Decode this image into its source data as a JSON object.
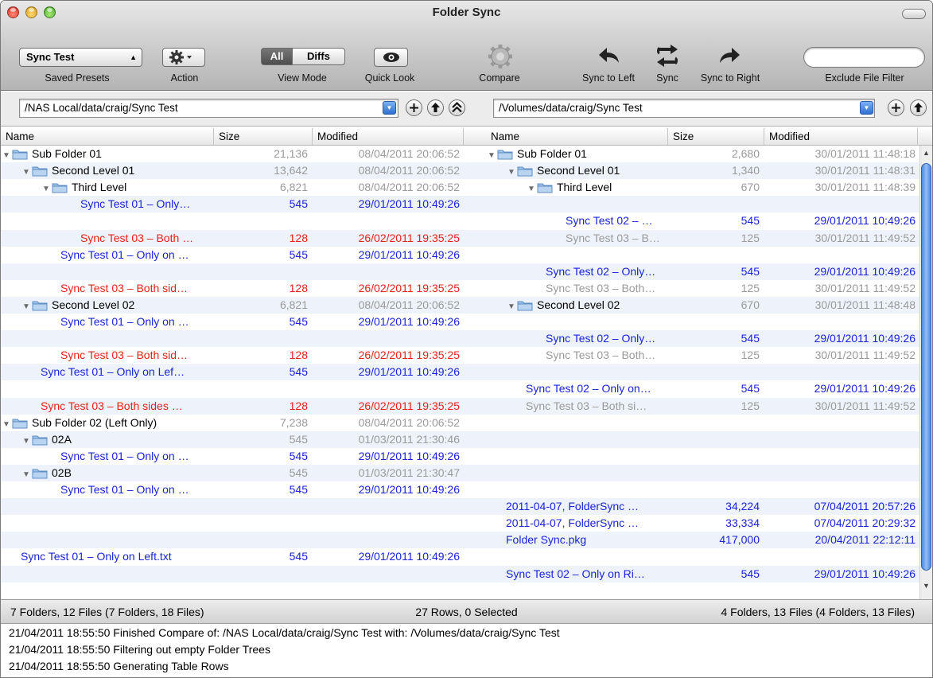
{
  "window": {
    "title": "Folder Sync"
  },
  "toolbar": {
    "preset_value": "Sync Test",
    "saved_presets_label": "Saved Presets",
    "action_label": "Action",
    "view_mode_label": "View Mode",
    "view_all": "All",
    "view_diffs": "Diffs",
    "quick_look_label": "Quick Look",
    "compare_label": "Compare",
    "sync_left_label": "Sync to Left",
    "sync_label": "Sync",
    "sync_right_label": "Sync to Right",
    "exclude_label": "Exclude File Filter",
    "exclude_value": ""
  },
  "paths": {
    "left": "/NAS Local/data/craig/Sync Test",
    "right": "/Volumes/data/craig/Sync Test"
  },
  "columns": {
    "name": "Name",
    "size": "Size",
    "modified": "Modified"
  },
  "rows": [
    {
      "l": {
        "name": "Sub Folder 01",
        "size": "21,136",
        "date": "08/04/2011 20:06:52",
        "c": "gray",
        "ind": 0,
        "folder": true
      },
      "r": {
        "name": "Sub Folder 01",
        "size": "2,680",
        "date": "30/01/2011 11:48:18",
        "c": "gray",
        "ind": 0,
        "folder": true
      }
    },
    {
      "l": {
        "name": "Second Level 01",
        "size": "13,642",
        "date": "08/04/2011 20:06:52",
        "c": "gray",
        "ind": 1,
        "folder": true
      },
      "r": {
        "name": "Second Level 01",
        "size": "1,340",
        "date": "30/01/2011 11:48:31",
        "c": "gray",
        "ind": 1,
        "folder": true
      }
    },
    {
      "l": {
        "name": "Third Level",
        "size": "6,821",
        "date": "08/04/2011 20:06:52",
        "c": "gray",
        "ind": 2,
        "folder": true
      },
      "r": {
        "name": "Third Level",
        "size": "670",
        "date": "30/01/2011 11:48:39",
        "c": "gray",
        "ind": 2,
        "folder": true
      }
    },
    {
      "l": {
        "name": "Sync Test 01 – Only…",
        "size": "545",
        "date": "29/01/2011 10:49:26",
        "c": "blue",
        "ind": 3
      },
      "r": null
    },
    {
      "l": null,
      "r": {
        "name": "Sync Test 02 – …",
        "size": "545",
        "date": "29/01/2011 10:49:26",
        "c": "blue",
        "ind": 3
      }
    },
    {
      "l": {
        "name": "Sync Test 03 – Both …",
        "size": "128",
        "date": "26/02/2011 19:35:25",
        "c": "red",
        "ind": 3
      },
      "r": {
        "name": "Sync Test 03 – B…",
        "size": "125",
        "date": "30/01/2011 11:49:52",
        "c": "gray",
        "ind": 3
      }
    },
    {
      "l": {
        "name": "Sync Test 01 – Only on …",
        "size": "545",
        "date": "29/01/2011 10:49:26",
        "c": "blue",
        "ind": 2
      },
      "r": null
    },
    {
      "l": null,
      "r": {
        "name": "Sync Test 02 – Only…",
        "size": "545",
        "date": "29/01/2011 10:49:26",
        "c": "blue",
        "ind": 2
      }
    },
    {
      "l": {
        "name": "Sync Test 03 – Both sid…",
        "size": "128",
        "date": "26/02/2011 19:35:25",
        "c": "red",
        "ind": 2
      },
      "r": {
        "name": "Sync Test 03 – Both…",
        "size": "125",
        "date": "30/01/2011 11:49:52",
        "c": "gray",
        "ind": 2
      }
    },
    {
      "l": {
        "name": "Second Level 02",
        "size": "6,821",
        "date": "08/04/2011 20:06:52",
        "c": "gray",
        "ind": 1,
        "folder": true
      },
      "r": {
        "name": "Second Level 02",
        "size": "670",
        "date": "30/01/2011 11:48:48",
        "c": "gray",
        "ind": 1,
        "folder": true
      }
    },
    {
      "l": {
        "name": "Sync Test 01 – Only on …",
        "size": "545",
        "date": "29/01/2011 10:49:26",
        "c": "blue",
        "ind": 2
      },
      "r": null
    },
    {
      "l": null,
      "r": {
        "name": "Sync Test 02 – Only…",
        "size": "545",
        "date": "29/01/2011 10:49:26",
        "c": "blue",
        "ind": 2
      }
    },
    {
      "l": {
        "name": "Sync Test 03 – Both sid…",
        "size": "128",
        "date": "26/02/2011 19:35:25",
        "c": "red",
        "ind": 2
      },
      "r": {
        "name": "Sync Test 03 – Both…",
        "size": "125",
        "date": "30/01/2011 11:49:52",
        "c": "gray",
        "ind": 2
      }
    },
    {
      "l": {
        "name": "Sync Test 01 – Only on Lef…",
        "size": "545",
        "date": "29/01/2011 10:49:26",
        "c": "blue",
        "ind": 1
      },
      "r": null
    },
    {
      "l": null,
      "r": {
        "name": "Sync Test 02 – Only on…",
        "size": "545",
        "date": "29/01/2011 10:49:26",
        "c": "blue",
        "ind": 1
      }
    },
    {
      "l": {
        "name": "Sync Test 03 – Both sides …",
        "size": "128",
        "date": "26/02/2011 19:35:25",
        "c": "red",
        "ind": 1
      },
      "r": {
        "name": "Sync Test 03 – Both si…",
        "size": "125",
        "date": "30/01/2011 11:49:52",
        "c": "gray",
        "ind": 1
      }
    },
    {
      "l": {
        "name": "Sub Folder 02 (Left Only)",
        "size": "7,238",
        "date": "08/04/2011 20:06:52",
        "c": "gray",
        "ind": 0,
        "folder": true
      },
      "r": null
    },
    {
      "l": {
        "name": "02A",
        "size": "545",
        "date": "01/03/2011 21:30:46",
        "c": "gray",
        "ind": 1,
        "folder": true
      },
      "r": null
    },
    {
      "l": {
        "name": "Sync Test 01 – Only on …",
        "size": "545",
        "date": "29/01/2011 10:49:26",
        "c": "blue",
        "ind": 2
      },
      "r": null
    },
    {
      "l": {
        "name": "02B",
        "size": "545",
        "date": "01/03/2011 21:30:47",
        "c": "gray",
        "ind": 1,
        "folder": true
      },
      "r": null
    },
    {
      "l": {
        "name": "Sync Test 01 – Only on …",
        "size": "545",
        "date": "29/01/2011 10:49:26",
        "c": "blue",
        "ind": 2
      },
      "r": null
    },
    {
      "l": null,
      "r": {
        "name": "2011-04-07, FolderSync …",
        "size": "34,224",
        "date": "07/04/2011 20:57:26",
        "c": "blue",
        "ind": 0
      }
    },
    {
      "l": null,
      "r": {
        "name": "2011-04-07, FolderSync …",
        "size": "33,334",
        "date": "07/04/2011 20:29:32",
        "c": "blue",
        "ind": 0
      }
    },
    {
      "l": null,
      "r": {
        "name": "Folder Sync.pkg",
        "size": "417,000",
        "date": "20/04/2011 22:12:11",
        "c": "blue",
        "ind": 0
      }
    },
    {
      "l": {
        "name": "Sync Test 01 – Only on Left.txt",
        "size": "545",
        "date": "29/01/2011 10:49:26",
        "c": "blue",
        "ind": 0
      },
      "r": null
    },
    {
      "l": null,
      "r": {
        "name": "Sync Test 02 – Only on Ri…",
        "size": "545",
        "date": "29/01/2011 10:49:26",
        "c": "blue",
        "ind": 0
      }
    }
  ],
  "status": {
    "left": "7 Folders, 12 Files (7 Folders, 18 Files)",
    "center": "27 Rows, 0 Selected",
    "right": "4 Folders, 13 Files (4 Folders, 13 Files)"
  },
  "log": [
    "21/04/2011 18:55:50  Finished Compare of: /NAS Local/data/craig/Sync Test with: /Volumes/data/craig/Sync Test",
    "21/04/2011 18:55:50  Filtering out empty Folder Trees",
    "21/04/2011 18:55:50  Generating Table Rows"
  ],
  "colors": {
    "only_one_side": "#1a24d6",
    "changed": "#e3241b",
    "unchanged": "#9a9a9a",
    "row_alt": "#edf2fb"
  },
  "icons": [
    "close-icon",
    "minimize-icon",
    "zoom-icon",
    "gear-icon",
    "eye-icon",
    "compare-gear-icon",
    "sync-left-icon",
    "sync-icon",
    "sync-right-icon",
    "folder-icon",
    "plus-icon",
    "up-arrow-icon",
    "double-up-icon"
  ]
}
